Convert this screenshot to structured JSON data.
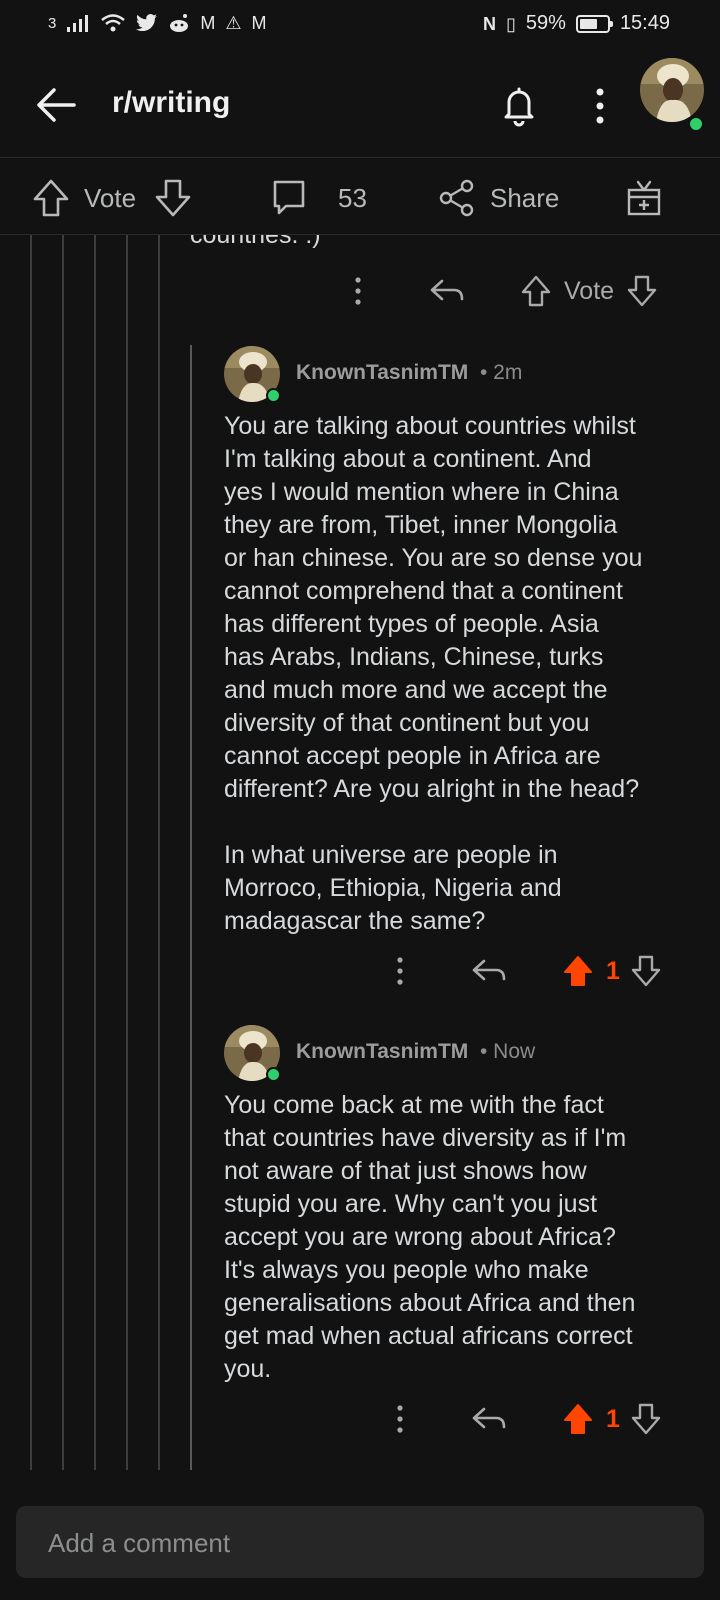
{
  "status": {
    "carrier": "3",
    "battery": "59%",
    "battery_level": 0.59,
    "time": "15:49"
  },
  "header": {
    "title": "r/writing"
  },
  "action_bar": {
    "vote_label": "Vote",
    "comment_count": "53",
    "share_label": "Share"
  },
  "thread": {
    "previous_text_tail": "countries. :)",
    "previous_actions": {
      "vote_label": "Vote"
    },
    "comments": [
      {
        "username": "KnownTasnimTM",
        "time": "• 2m",
        "body": "You are talking about countries whilst\nI'm talking about a continent. And\nyes I would mention where in China\nthey are from, Tibet, inner Mongolia\nor han chinese. You are so dense you\ncannot comprehend that a continent\nhas different types of people. Asia\nhas Arabs, Indians, Chinese, turks\nand much more and we accept the\ndiversity of that continent but you\ncannot accept people in Africa are\ndifferent? Are you alright in the head?\n\nIn what universe are people in\nMorroco, Ethiopia, Nigeria and\nmadagascar the same?",
        "votes": "1"
      },
      {
        "username": "KnownTasnimTM",
        "time": "• Now",
        "body": "You come back at me with the fact\nthat countries have diversity as if I'm\nnot aware of that just shows how\nstupid you are. Why can't you just\naccept you are wrong about Africa?\nIt's always you people who make\ngeneralisations about Africa and then\nget mad when actual africans correct\nyou.",
        "votes": "1"
      }
    ]
  },
  "composer": {
    "placeholder": "Add a comment"
  },
  "colors": {
    "background": "#121212",
    "upvote_active": "#ff4500",
    "online": "#2fd06b",
    "text": "#d7dadc",
    "muted": "#a8aaab"
  }
}
